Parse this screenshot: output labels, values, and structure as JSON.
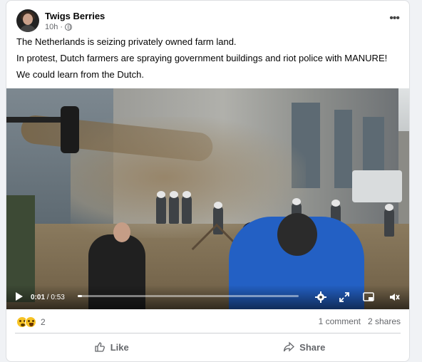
{
  "post": {
    "author": "Twigs Berries",
    "time": "10h",
    "privacy_icon": "globe-icon",
    "more_label": "•••",
    "lines": [
      "The Netherlands is seizing privately owned farm land.",
      "In protest, Dutch farmers are spraying government buildings and riot police with MANURE!",
      "We could learn from the Dutch."
    ]
  },
  "video": {
    "current_time": "0:01",
    "separator": " / ",
    "duration": "0:53",
    "progress_fraction": 0.02,
    "icons": [
      "play-icon",
      "settings-gear-icon",
      "expand-icon",
      "picture-in-picture-icon",
      "volume-icon"
    ]
  },
  "footer": {
    "reaction_icons": [
      "wow-emoji-icon",
      "haha-emoji-icon"
    ],
    "reaction_count": "2",
    "comments": "1 comment",
    "shares": "2 shares",
    "like_label": "Like",
    "share_label": "Share"
  },
  "colors": {
    "video_blue_jacket": "#2360c4",
    "link_gray": "#65676b",
    "reaction_yellow": "#f7c325"
  }
}
